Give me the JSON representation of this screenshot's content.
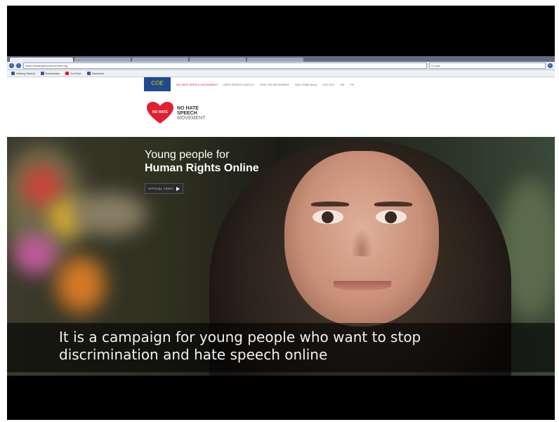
{
  "browser": {
    "url": "www.nohatespeechmovement.org",
    "search_placeholder": "Google",
    "bookmarks": [
      "Getting Started",
      "Bookmarks",
      "YouTube",
      "Facebook"
    ]
  },
  "site": {
    "coe_logo_text": "COE",
    "toplinks": [
      "NO HATE SPEECH MOVEMENT",
      "HATE SPEECH WATCH",
      "JOIN THE MOVEMENT",
      "WELCOME Anna",
      "LOG OUT",
      "EN",
      "FR"
    ],
    "heart_text": "NO HATE",
    "brand_lines": [
      "NO HATE",
      "SPEECH",
      "MOVEMENT"
    ]
  },
  "hero": {
    "title_line1": "Young people for",
    "title_line2": "Human Rights Online",
    "video_button": "OFFICIAL VIDEO"
  },
  "caption": {
    "line1": "It is a campaign for young people who want to stop",
    "line2": "discrimination and hate speech online"
  },
  "colors": {
    "brand_red": "#e0212f",
    "coe_blue": "#1f4b8e",
    "caption_bg": "#000000"
  }
}
